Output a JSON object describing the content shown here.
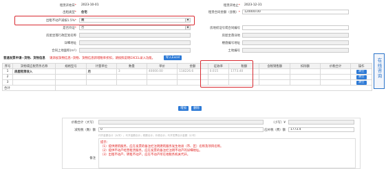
{
  "top_form": {
    "left": [
      {
        "label": "租赁开始日",
        "required": true,
        "value": "2023-10-01"
      },
      {
        "label": "出租类型",
        "required": true,
        "value": "住宅"
      },
      {
        "label": "出租不动产减按1.5%",
        "required": true,
        "value": "是"
      },
      {
        "label": "是否持证",
        "required": true,
        "value": "否"
      },
      {
        "label": "房屋坐落行政区划名称",
        "required": false,
        "value": ""
      },
      {
        "label": "详细地址",
        "required": false,
        "value": ""
      },
      {
        "label": "合同上地面积(m²)",
        "required": false,
        "value": ""
      }
    ],
    "right": [
      {
        "label": "租赁开始止",
        "required": true,
        "value": "2023-12-31"
      },
      {
        "label": "租赁合同金额（含税）",
        "required": true,
        "value": "120000.00"
      },
      {
        "label": "",
        "required": false,
        "value": ""
      },
      {
        "label": "房地权证号或合同编号",
        "required": false,
        "value": ""
      },
      {
        "label": "房屋坐落详地",
        "required": false,
        "value": ""
      },
      {
        "label": "楼盘编号地址",
        "required": false,
        "value": ""
      },
      {
        "label": "土地编号",
        "required": false,
        "value": ""
      }
    ]
  },
  "notice": {
    "title": "普通发票申请--货物、货物信息",
    "warning": "请添加货物信息--货物、货物信息新增税率折扣，请按照说明EXCEL录入功能。",
    "import_button": "导入Excel"
  },
  "table": {
    "headers": [
      "序号",
      "货物或应税劳务名称",
      "规格型号",
      "计量单位",
      "数量",
      "单价",
      "金额",
      "征收率",
      "税额",
      "含税销售额",
      "扣除额",
      "价税合计",
      "操作"
    ],
    "rows": [
      {
        "no": "1",
        "name": "房屋租赁收入",
        "spec": "",
        "unit": "月",
        "qty": "3",
        "price": "40000.00",
        "amount": "118226.6",
        "rate": "0.015",
        "tax": "1773.40",
        "gross": "",
        "deduct": "",
        "total": "",
        "action": "清空"
      },
      {
        "no": "2",
        "name": "",
        "spec": "",
        "unit": "",
        "qty": "",
        "price": "",
        "amount": "",
        "rate": "",
        "tax": "",
        "gross": "",
        "deduct": "",
        "total": "",
        "action": "清空"
      },
      {
        "no": "3",
        "name": "",
        "spec": "",
        "unit": "",
        "qty": "",
        "price": "",
        "amount": "",
        "rate": "",
        "tax": "",
        "gross": "",
        "deduct": "",
        "total": "",
        "action": "清空"
      }
    ],
    "total_label": "合计",
    "add_button": "增加",
    "delete_button": "删除"
  },
  "summary": {
    "price_tax_label": "价税合计（大写）",
    "price_tax_value": "",
    "small_label": "（小写）¥",
    "small_value": "",
    "reduce_label": "减免税（数）额",
    "reduce_value": "0",
    "tax_due_label": "应补税（费）额",
    "tax_due_value": "1773.4",
    "footnote": "代开金额合计（大写）；代开金额合计；税额合计；价税合计；代开发票合计金额（小写）",
    "remark_label": "备注",
    "remark_title": "提示：",
    "remark_lines": [
      "（1）提供建筑服务，应在发票的备注栏注明建筑服务发生地县（市、区）名称及项目名称。",
      "（2）提供不动产经营租赁服务，应在发票的备注栏注明不动产的详细地址。",
      "（3）出租不动产、转租不动产，应在不动产所在地税务机关代开。"
    ]
  },
  "online_help": "在线咨询",
  "colors": {
    "highlight_box": "#d9282f",
    "primary_button": "#2d7ad6",
    "warning_text": "#e0201f",
    "help_tab": "#2a73c9"
  }
}
